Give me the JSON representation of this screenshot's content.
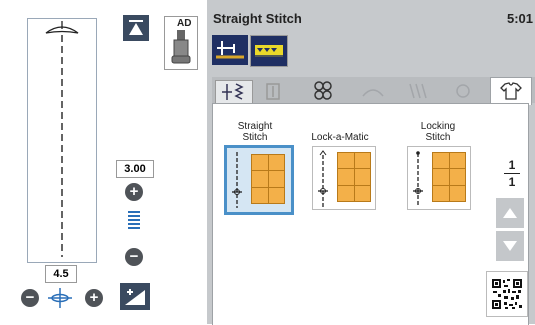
{
  "left": {
    "length_value": "3.00",
    "width_value": "4.5",
    "plus_glyph": "+",
    "minus_glyph": "−",
    "auto_decrease_label": "AD"
  },
  "header": {
    "title": "Straight Stitch",
    "time": "5:01"
  },
  "stitches": [
    {
      "label": "Straight Stitch",
      "line1": "Straight",
      "line2": "Stitch"
    },
    {
      "label": "Lock-a-Matic",
      "line1": "Lock-a-Matic",
      "line2": ""
    },
    {
      "label": "Locking Stitch",
      "line1": "Locking",
      "line2": "Stitch"
    }
  ],
  "pager": {
    "current": "1",
    "total": "1"
  },
  "colors": {
    "accent_blue": "#4a90c8",
    "tile_orange": "#f3b049",
    "panel_gray": "#c6c9cc",
    "dark_button": "#3a4a60"
  }
}
